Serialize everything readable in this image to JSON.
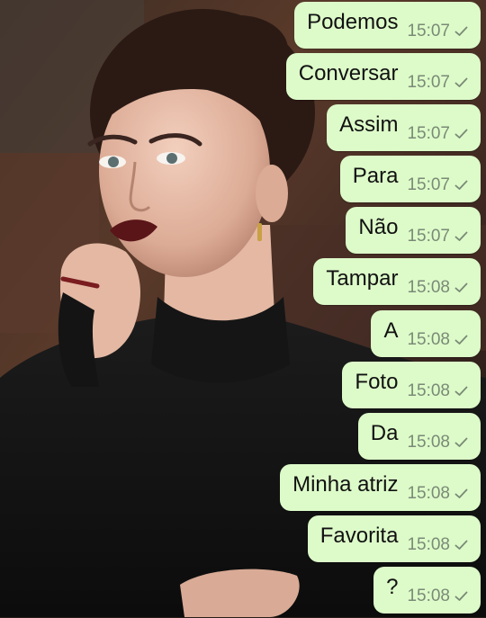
{
  "chat": {
    "messages": [
      {
        "text": "Podemos",
        "time": "15:07",
        "status_icon": "single-check-icon"
      },
      {
        "text": "Conversar",
        "time": "15:07",
        "status_icon": "single-check-icon"
      },
      {
        "text": "Assim",
        "time": "15:07",
        "status_icon": "single-check-icon"
      },
      {
        "text": "Para",
        "time": "15:07",
        "status_icon": "single-check-icon"
      },
      {
        "text": "Não",
        "time": "15:07",
        "status_icon": "single-check-icon"
      },
      {
        "text": "Tampar",
        "time": "15:08",
        "status_icon": "single-check-icon"
      },
      {
        "text": "A",
        "time": "15:08",
        "status_icon": "single-check-icon"
      },
      {
        "text": "Foto",
        "time": "15:08",
        "status_icon": "single-check-icon"
      },
      {
        "text": "Da",
        "time": "15:08",
        "status_icon": "single-check-icon"
      },
      {
        "text": "Minha atriz",
        "time": "15:08",
        "status_icon": "single-check-icon"
      },
      {
        "text": "Favorita",
        "time": "15:08",
        "status_icon": "single-check-icon"
      },
      {
        "text": "?",
        "time": "15:08",
        "status_icon": "single-check-icon"
      }
    ]
  },
  "colors": {
    "bubble_background": "#ddfbc9",
    "message_text": "#111111",
    "timestamp": "#7a8a76"
  }
}
